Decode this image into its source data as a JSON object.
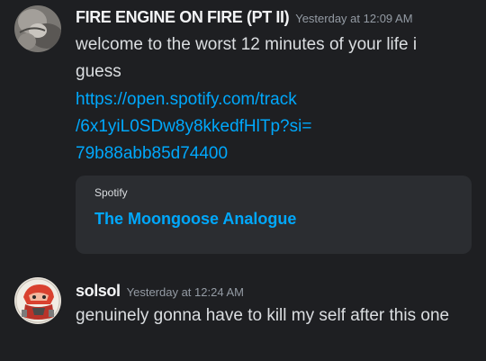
{
  "messages": [
    {
      "username": "FIRE ENGINE ON FIRE (PT II)",
      "timestamp": "Yesterday at 12:09 AM",
      "text": "welcome to the worst 12 minutes of your life i guess",
      "link": {
        "line1": "https://open.spotify.com/track",
        "line2": "/6x1yiL0SDw8y8kkedfHlTp?si=",
        "line3": "79b88abb85d74400"
      },
      "embed": {
        "provider": "Spotify",
        "title": "The Moongoose Analogue"
      }
    },
    {
      "username": "solsol",
      "timestamp": "Yesterday at 12:24 AM",
      "text": "genuinely gonna have to kill my self after this one"
    }
  ],
  "colors": {
    "background": "#1e1f22",
    "embed_background": "#2b2d31",
    "link": "#00a8fc",
    "username": "#f2f3f5",
    "timestamp": "#949ba4",
    "text": "#dbdee1"
  }
}
